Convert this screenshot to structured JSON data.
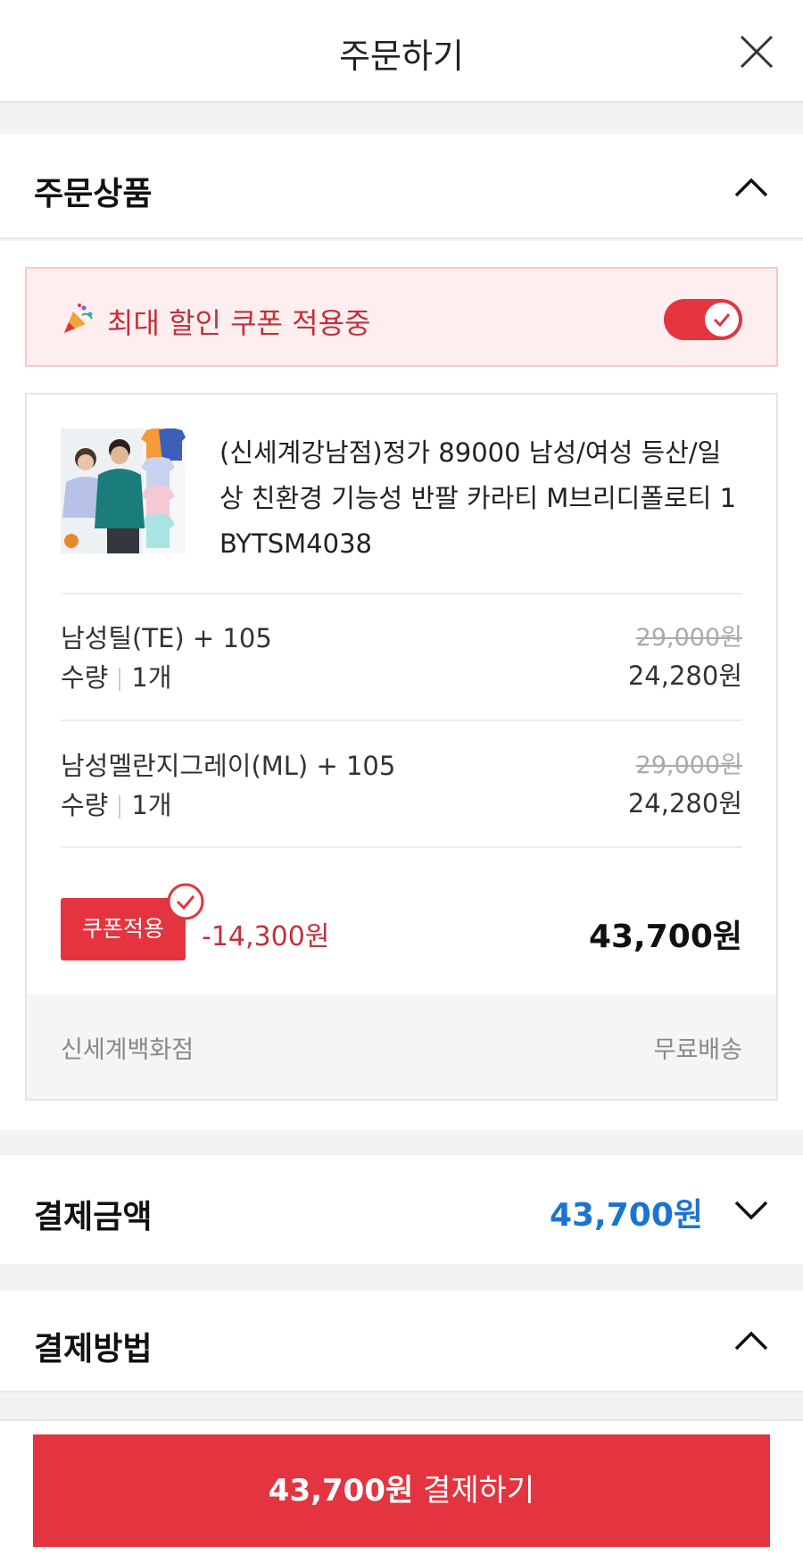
{
  "header": {
    "title": "주문하기"
  },
  "order_items": {
    "label": "주문상품",
    "coupon_banner": {
      "text": "최대 할인 쿠폰 적용중",
      "enabled": true
    },
    "product": {
      "name": "(신세계강남점)정가 89000 남성/여성 등산/일상 친환경 기능성 반팔 카라티 M브리디폴로티 1BYTSM4038",
      "name_line1": "(신세계강남점)정가 89000 남성/여성 등산/일",
      "name_line2": "상 친환경 기능성 반팔 카라티 M브리디폴로티 1",
      "name_line3": "BYTSM4038"
    },
    "options": [
      {
        "name": "남성틸(TE) + 105",
        "qty_label": "수량",
        "qty": "1개",
        "original_price": "29,000원",
        "price": "24,280원"
      },
      {
        "name": "남성멜란지그레이(ML) + 105",
        "qty_label": "수량",
        "qty": "1개",
        "original_price": "29,000원",
        "price": "24,280원"
      }
    ],
    "coupon_button": "쿠폰적용",
    "discount": "-14,300원",
    "total": "43,700원",
    "store": "신세계백화점",
    "shipping": "무료배송"
  },
  "payment_amount": {
    "label": "결제금액",
    "value": "43,700원"
  },
  "payment_method": {
    "label": "결제방법"
  },
  "pay_button": {
    "amount": "43,700원",
    "label": "결제하기"
  },
  "colors": {
    "accent_red": "#e4343f",
    "blue": "#1b74d1",
    "banner_bg": "#fdefef"
  }
}
